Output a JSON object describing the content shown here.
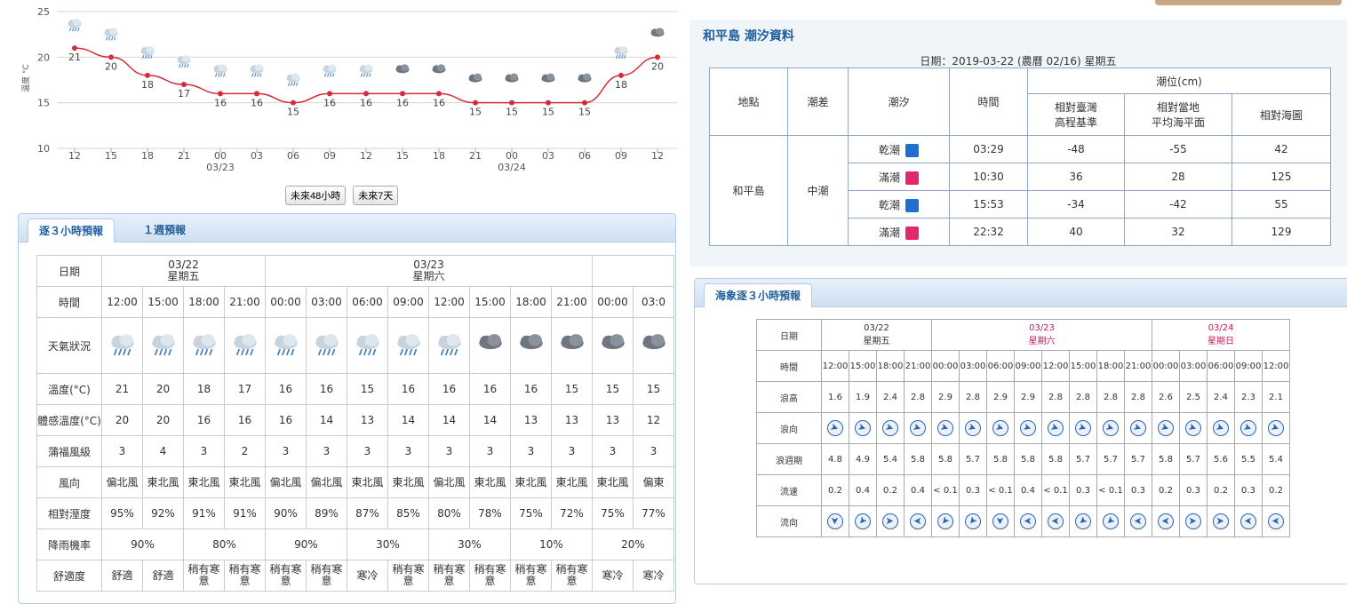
{
  "chart": {
    "yaxis_label": "溫度 °C",
    "y_ticks": [
      "25",
      "20",
      "15",
      "10"
    ],
    "x_ticks": [
      "12",
      "15",
      "18",
      "21",
      "00",
      "03",
      "06",
      "09",
      "12",
      "15",
      "18",
      "21",
      "00",
      "03",
      "06",
      "09",
      "12"
    ],
    "date_labels": [
      {
        "after": 4,
        "text": "03/23"
      },
      {
        "after": 12,
        "text": "03/24"
      }
    ],
    "temps": [
      21,
      20,
      18,
      17,
      16,
      16,
      15,
      16,
      16,
      16,
      16,
      15,
      15,
      15,
      15,
      18,
      20
    ],
    "icons": [
      "rain",
      "rain",
      "rain",
      "rain",
      "rain",
      "rain",
      "rain",
      "rain",
      "rain",
      "cloud",
      "cloud",
      "cloud",
      "cloud",
      "cloud",
      "cloud",
      "rain",
      "cloud"
    ],
    "ylim": [
      10,
      25
    ],
    "line_color": "#d62c3a",
    "btn_48h": "未來48小時",
    "btn_7d": "未來7天"
  },
  "forecast": {
    "tab_3h": "逐３小時預報",
    "tab_week": "１週預報",
    "row_labels": {
      "date": "日期",
      "time": "時間",
      "weather": "天氣狀況",
      "temp": "溫度(°C)",
      "feel": "體感溫度(°C)",
      "wind": "蒲福風級",
      "dir": "風向",
      "hum": "相對溼度",
      "rain": "降雨機率",
      "comfort": "舒適度"
    },
    "dates": [
      {
        "d": "03/22",
        "w": "星期五",
        "span": 4,
        "red": false
      },
      {
        "d": "03/23",
        "w": "星期六",
        "span": 8,
        "red": true
      },
      {
        "d": "",
        "w": "",
        "span": 2,
        "red": false
      }
    ],
    "times": [
      "12:00",
      "15:00",
      "18:00",
      "21:00",
      "00:00",
      "03:00",
      "06:00",
      "09:00",
      "12:00",
      "15:00",
      "18:00",
      "21:00",
      "00:00",
      "03:0"
    ],
    "weather": [
      "rain",
      "rain",
      "rain",
      "rain",
      "rain",
      "rain",
      "rain",
      "rain",
      "rain",
      "cloud",
      "cloud",
      "cloud",
      "cloud",
      "cloud"
    ],
    "temp": [
      "21",
      "20",
      "18",
      "17",
      "16",
      "16",
      "15",
      "16",
      "16",
      "16",
      "16",
      "15",
      "15",
      "15"
    ],
    "feel": [
      "20",
      "20",
      "16",
      "16",
      "16",
      "14",
      "13",
      "14",
      "14",
      "14",
      "13",
      "13",
      "13",
      "12"
    ],
    "wind": [
      "3",
      "4",
      "3",
      "2",
      "3",
      "3",
      "3",
      "3",
      "3",
      "3",
      "3",
      "3",
      "3",
      "3"
    ],
    "dir": [
      "偏北風",
      "東北風",
      "東北風",
      "東北風",
      "偏北風",
      "偏北風",
      "東北風",
      "東北風",
      "偏北風",
      "東北風",
      "東北風",
      "東北風",
      "東北風",
      "偏東"
    ],
    "hum": [
      "95%",
      "92%",
      "91%",
      "91%",
      "90%",
      "89%",
      "87%",
      "85%",
      "80%",
      "78%",
      "75%",
      "72%",
      "75%",
      "77%"
    ],
    "rain": [
      "90%",
      "80%",
      "90%",
      "30%",
      "30%",
      "10%",
      "20%"
    ],
    "comfort": [
      "舒適",
      "舒適",
      "稍有寒意",
      "稍有寒意",
      "稍有寒意",
      "稍有寒意",
      "寒冷",
      "稍有寒意",
      "稍有寒意",
      "稍有寒意",
      "稍有寒意",
      "稍有寒意",
      "寒冷",
      "寒冷"
    ]
  },
  "tide": {
    "title": "和平島 潮汐資料",
    "date_line": "日期：2019-03-22 (農曆 02/16) 星期五",
    "h_location": "地點",
    "h_range": "潮差",
    "h_tide": "潮汐",
    "h_time": "時間",
    "h_level": "潮位(cm)",
    "h_tw1": "相對臺灣",
    "h_tw2": "高程基準",
    "h_local1": "相對當地",
    "h_local2": "平均海平面",
    "h_chart": "相對海圖",
    "location": "和平島",
    "range": "中潮",
    "rows": [
      {
        "type": "乾潮",
        "low": true,
        "time": "03:29",
        "tw": "-48",
        "local": "-55",
        "chart": "42"
      },
      {
        "type": "滿潮",
        "low": false,
        "time": "10:30",
        "tw": "36",
        "local": "28",
        "chart": "125"
      },
      {
        "type": "乾潮",
        "low": true,
        "time": "15:53",
        "tw": "-34",
        "local": "-42",
        "chart": "55"
      },
      {
        "type": "滿潮",
        "low": false,
        "time": "22:32",
        "tw": "40",
        "local": "32",
        "chart": "129"
      }
    ]
  },
  "sea": {
    "tab": "海象逐３小時預報",
    "row_labels": {
      "date": "日期",
      "time": "時間",
      "wave": "浪高",
      "wdir": "浪向",
      "period": "浪週期",
      "speed": "流速",
      "cdir": "流向"
    },
    "dates": [
      {
        "d": "03/22",
        "w": "星期五",
        "span": 4,
        "red": false
      },
      {
        "d": "03/23",
        "w": "星期六",
        "span": 8,
        "red": true
      },
      {
        "d": "03/24",
        "w": "星期日",
        "span": 5,
        "red": true
      }
    ],
    "times": [
      "12:00",
      "15:00",
      "18:00",
      "21:00",
      "00:00",
      "03:00",
      "06:00",
      "09:00",
      "12:00",
      "15:00",
      "18:00",
      "21:00",
      "00:00",
      "03:00",
      "06:00",
      "09:00",
      "12:00"
    ],
    "wave": [
      "1.6",
      "1.9",
      "2.4",
      "2.8",
      "2.9",
      "2.8",
      "2.9",
      "2.9",
      "2.8",
      "2.8",
      "2.8",
      "2.8",
      "2.6",
      "2.5",
      "2.4",
      "2.3",
      "2.1"
    ],
    "wave_dir_deg": [
      110,
      110,
      110,
      110,
      110,
      110,
      110,
      110,
      110,
      110,
      110,
      110,
      110,
      110,
      110,
      110,
      110
    ],
    "period": [
      "4.8",
      "4.9",
      "5.4",
      "5.8",
      "5.8",
      "5.7",
      "5.8",
      "5.8",
      "5.8",
      "5.7",
      "5.7",
      "5.7",
      "5.8",
      "5.7",
      "5.6",
      "5.5",
      "5.4"
    ],
    "speed": [
      "0.2",
      "0.4",
      "0.2",
      "0.4",
      "< 0.1",
      "0.3",
      "< 0.1",
      "0.4",
      "< 0.1",
      "0.3",
      "< 0.1",
      "0.3",
      "0.2",
      "0.3",
      "0.2",
      "0.3",
      "0.2"
    ],
    "cur_dir_deg": [
      180,
      220,
      90,
      270,
      220,
      220,
      180,
      270,
      270,
      230,
      230,
      270,
      270,
      90,
      90,
      270,
      270
    ]
  }
}
